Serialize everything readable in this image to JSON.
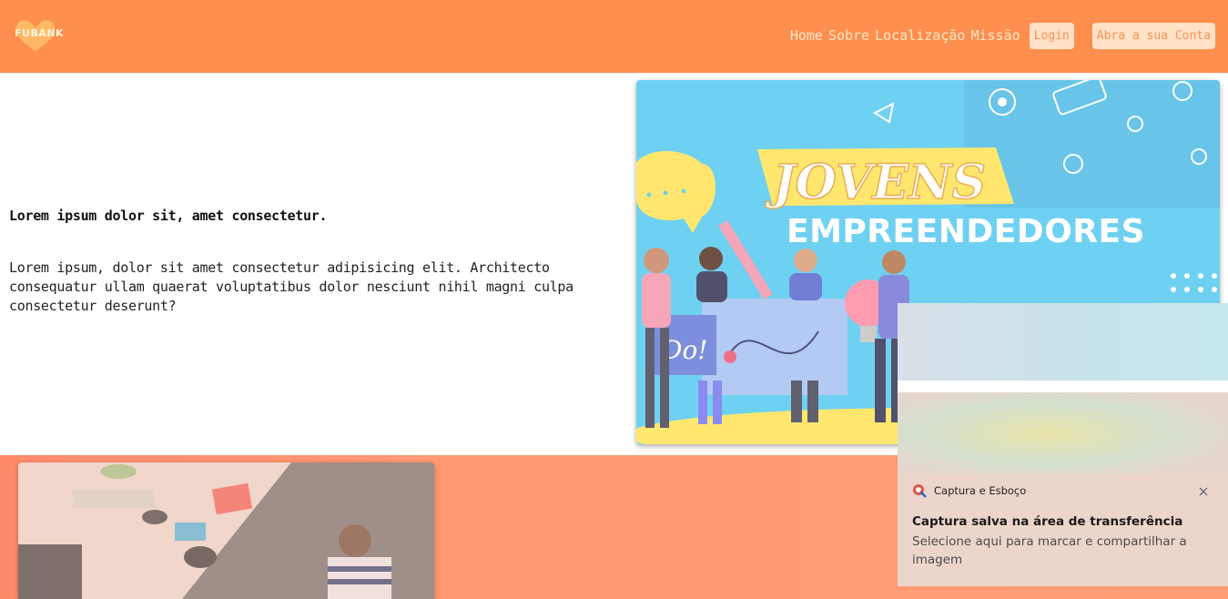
{
  "header": {
    "logo_text": "FUBANK",
    "nav": [
      "Home",
      "Sobre",
      "Localização",
      "Missão"
    ],
    "login_label": "Login",
    "open_account_label": "Abra a sua Conta"
  },
  "hero": {
    "title": "Lorem ipsum dolor sit, amet consectetur.",
    "body": "Lorem ipsum, dolor sit amet consectetur adipisicing elit. Architecto consequatur ullam quaerat voluptatibus dolor nesciunt nihil magni culpa consectetur deserunt?",
    "image": {
      "line1": "JOVENS",
      "line2": "EMPREENDEDORES",
      "sign": "Do!"
    }
  },
  "toast": {
    "app_name": "Captura e Esboço",
    "title": "Captura salva na área de transferência",
    "message": "Selecione aqui para marcar e compartilhar a imagem"
  },
  "colors": {
    "header": "#ff8f4f",
    "band": "#ff9a74",
    "hero_image_bg": "#5ccbf0"
  }
}
